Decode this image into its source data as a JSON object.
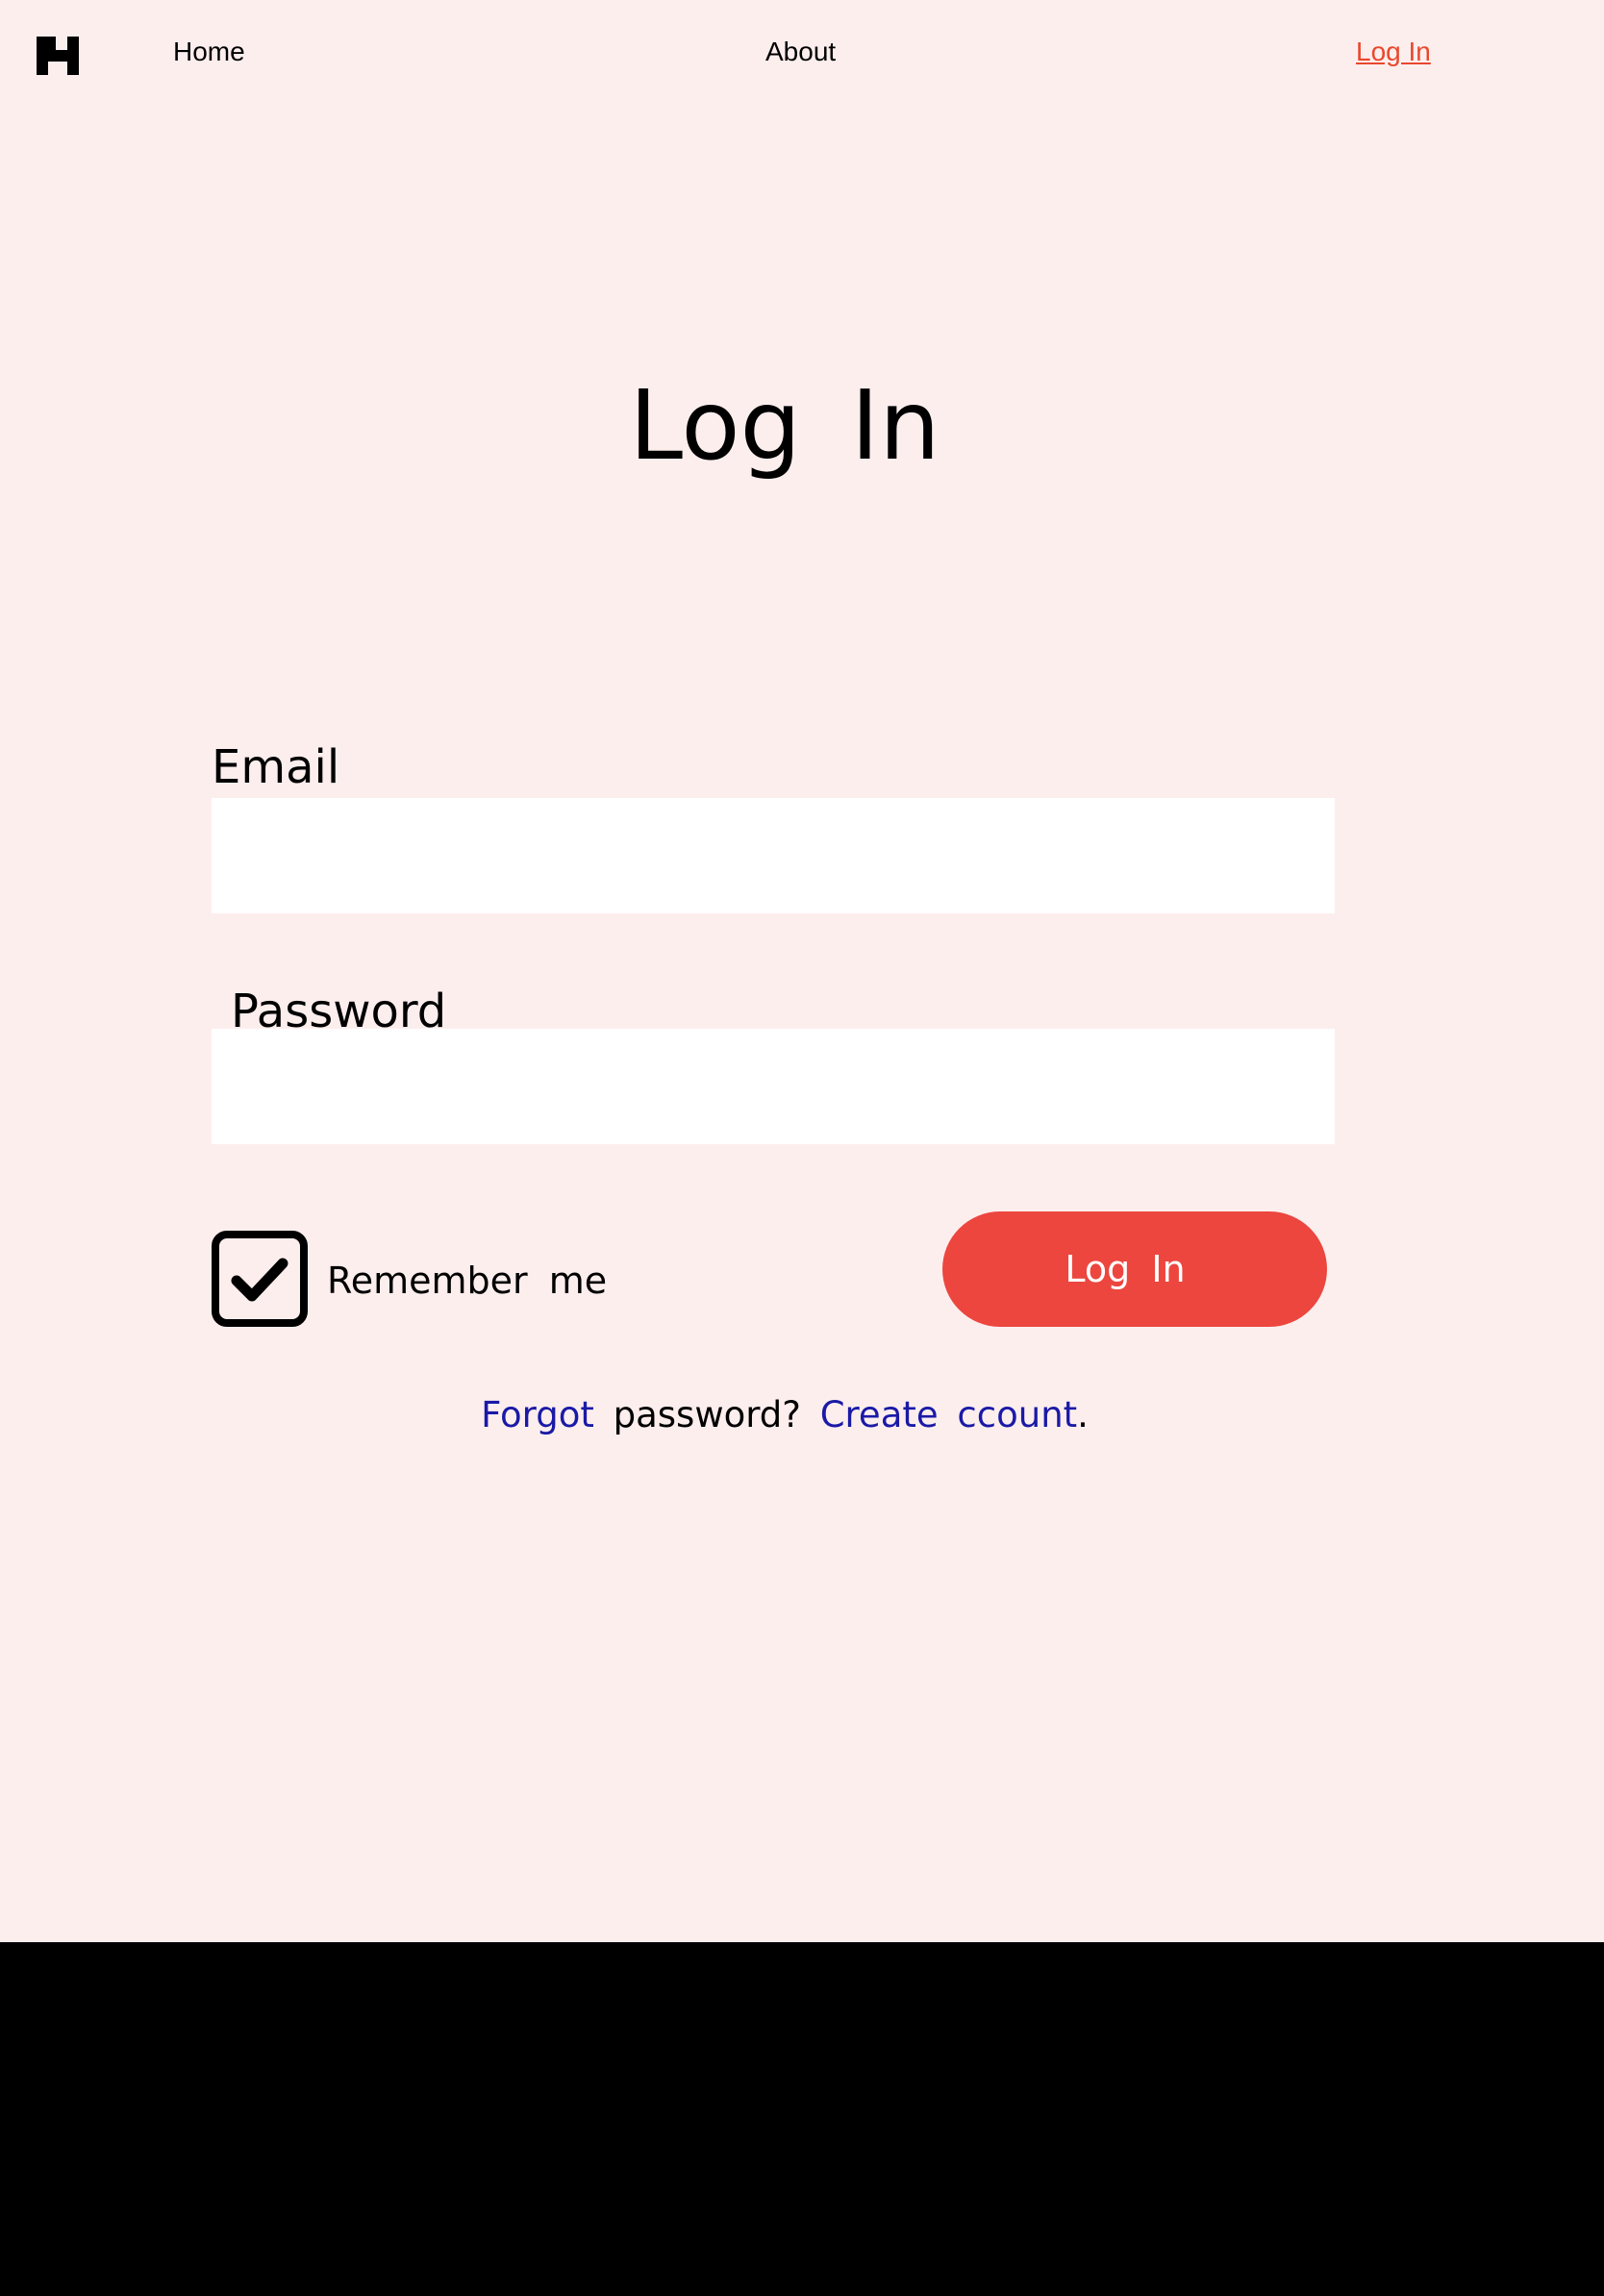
{
  "nav": {
    "logo_icon": "h-logo-icon",
    "home_label": "Home",
    "about_label": "About",
    "login_label": "Log In",
    "login_color": "#e8482c"
  },
  "main": {
    "title": "Log In",
    "email": {
      "label": "Email",
      "value": "",
      "placeholder": ""
    },
    "password": {
      "label": "Password",
      "value": "",
      "placeholder": ""
    },
    "remember": {
      "label": "Remember me",
      "checked": true,
      "icon": "checkbox-checked-icon"
    },
    "submit_label": "Log In",
    "submit_color": "#ec463f",
    "links": {
      "forgot_label": "Forgot",
      "middle_text": "password?",
      "create_label": "Create",
      "account_label": "ccount",
      "trailing": ".",
      "link_color": "#1a1aa6"
    }
  },
  "colors": {
    "background": "#fdeeee",
    "footer": "#000000"
  }
}
